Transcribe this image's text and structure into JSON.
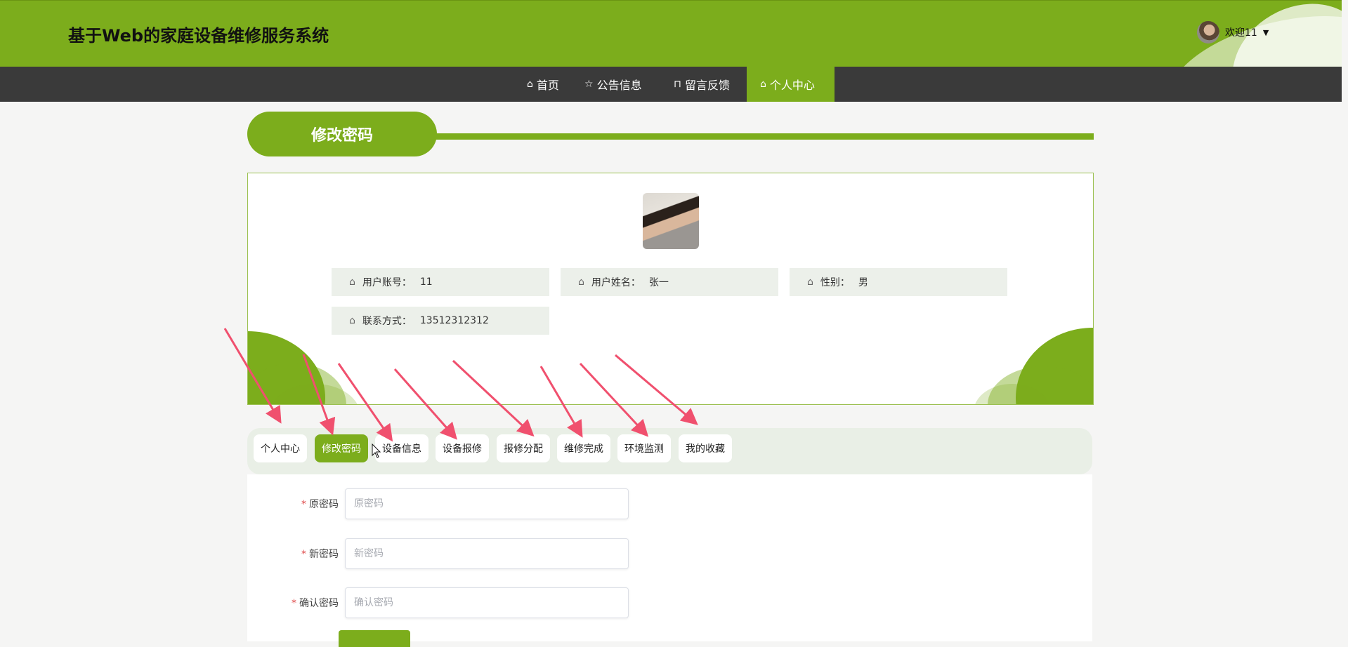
{
  "header": {
    "title": "基于Web的家庭设备维修服务系统",
    "user_label": "欢迎11"
  },
  "nav": {
    "items": [
      {
        "label": "首页",
        "icon": "home-icon"
      },
      {
        "label": "公告信息",
        "icon": "star-icon"
      },
      {
        "label": "留言反馈",
        "icon": "bag-icon"
      },
      {
        "label": "个人中心",
        "icon": "home-icon",
        "active": true
      }
    ]
  },
  "section": {
    "title": "修改密码"
  },
  "profile": {
    "fields": [
      {
        "label": "用户账号：",
        "value": "11"
      },
      {
        "label": "用户姓名：",
        "value": "张一"
      },
      {
        "label": "性别：",
        "value": "男"
      },
      {
        "label": "联系方式：",
        "value": "13512312312"
      }
    ]
  },
  "tabs": [
    {
      "label": "个人中心"
    },
    {
      "label": "修改密码",
      "active": true
    },
    {
      "label": "设备信息"
    },
    {
      "label": "设备报修"
    },
    {
      "label": "报修分配"
    },
    {
      "label": "维修完成"
    },
    {
      "label": "环境监测"
    },
    {
      "label": "我的收藏"
    }
  ],
  "form": {
    "old_password": {
      "label": "原密码",
      "placeholder": "原密码",
      "value": ""
    },
    "new_password": {
      "label": "新密码",
      "placeholder": "新密码",
      "value": ""
    },
    "confirm_password": {
      "label": "确认密码",
      "placeholder": "确认密码",
      "value": ""
    }
  },
  "colors": {
    "brand_green": "#7cad1c",
    "nav_dark": "#3a3a3a",
    "arrow_red": "#f0506e",
    "required_star": "#e04f4f"
  }
}
